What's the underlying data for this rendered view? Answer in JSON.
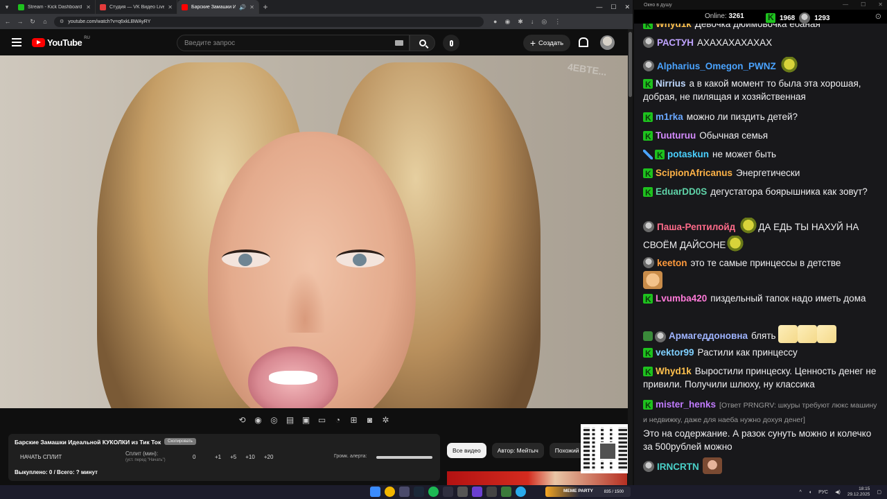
{
  "browser": {
    "tabs": [
      {
        "title": "Stream - Kick Dashboard",
        "color": "#1ec21e"
      },
      {
        "title": "Студия — VK Видео Live",
        "color": "#e33b3b"
      },
      {
        "title": "Барские Замашки Идеальной",
        "color": "#ff0000"
      }
    ],
    "url": "youtube.com/watch?v=q6xkLBWAyRY"
  },
  "youtube": {
    "logo_text": "YouTube",
    "region": "RU",
    "search_placeholder": "Введите запрос",
    "create_label": "Создать",
    "watermark": "4EBTE..."
  },
  "extension": {
    "video_title": "Барские Замашки Идеальной КУКОЛКИ из Тик Ток",
    "copy_pill": "Скопировать",
    "start_split": "НАЧАТЬ СПЛИТ",
    "split_label": "Сплит (мин):",
    "split_hint": "(уст. перед \"Начать\")",
    "split_value": "0",
    "increments": [
      "+1",
      "+5",
      "+10",
      "+20"
    ],
    "volume_label": "Громк. алерта:",
    "bought": "Выкуплено: 0 / Всего: ? минут"
  },
  "chips": [
    "Все видео",
    "Автор: Мейтыч",
    "Похожий к"
  ],
  "chat_window": {
    "title": "Окно в душу",
    "online_label": "Online:",
    "online_count": "3261",
    "kick_count": "1968",
    "twitch_count": "1293"
  },
  "chat": [
    {
      "user": "РАСТУН",
      "color": "#bfa3ff",
      "text": "АХАХАХАХАХАХ",
      "badges": [
        "twitch"
      ]
    },
    {
      "user": "Alpharius_Omegon_PWNZ",
      "color": "#4aa3ff",
      "text": "",
      "badges": [
        "twitch"
      ],
      "emote": "pepe"
    },
    {
      "user": "Nirrius",
      "color": "#bfd9ff",
      "text": "а в какой момент то была эта хорошая, добрая, не пилящая и хозяйственная",
      "badges": [
        "kick"
      ]
    },
    {
      "user": "m1rka",
      "color": "#6aa8ff",
      "text": "можно ли пиздить детей?",
      "badges": [
        "kick"
      ]
    },
    {
      "user": "Tuuturuu",
      "color": "#d58cff",
      "text": "Обычная семья",
      "badges": [
        "kick"
      ]
    },
    {
      "user": "potaskun",
      "color": "#4ad0ff",
      "text": "не может быть",
      "badges": [
        "sword",
        "kick"
      ]
    },
    {
      "user": "ScipionAfricanus",
      "color": "#ffb347",
      "text": "Энергетически",
      "badges": [
        "kick"
      ]
    },
    {
      "user": "EduarDD0S",
      "color": "#5fd3a8",
      "text": "дегустатора боярышника как зовут?",
      "badges": [
        "kick"
      ]
    },
    {
      "user": "Паша-Рептилойд",
      "color": "#ff6b8a",
      "text": "ДА ЕДЬ ТЫ НАХУЙ НА СВОЁМ ДАЙСОНЕ",
      "badges": [
        "twitch"
      ]
    },
    {
      "user": "keeton",
      "color": "#ff9a3c",
      "text": "это те самые принцессы в детстве",
      "badges": [
        "twitch"
      ]
    },
    {
      "user": "Lvumba420",
      "color": "#ff7ad9",
      "text": "пиздельный тапок надо иметь дома",
      "badges": [
        "kick"
      ]
    },
    {
      "user": "Армагеддоновна",
      "color": "#9fb4ff",
      "text": "блять",
      "badges": [
        "shield",
        "twitch"
      ]
    },
    {
      "user": "vektor99",
      "color": "#7fd0ff",
      "text": "Растили как принцессу",
      "badges": [
        "kick"
      ]
    },
    {
      "user": "Whyd1k",
      "color": "#ffc14d",
      "text": "Выростили принцеску. Ценность денег не привили. Получили шлюху, ну классика",
      "badges": [
        "kick"
      ]
    },
    {
      "user": "mister_henks",
      "color": "#c17bff",
      "reply": "[Ответ PRNGRV: шкуры требуют люкс машину и недвижку, даже для наеба нужно дохуя денег]",
      "text": "Это на содержание. А разок сунуть можно и колечко за 500рублей можно",
      "badges": [
        "kick"
      ]
    },
    {
      "user": "IRNCRTN",
      "color": "#4ad0c8",
      "text": "",
      "badges": [
        "twitch"
      ],
      "emote": "face"
    }
  ],
  "taskbar": {
    "meme_label": "MEME PARTY",
    "meme_count": "835 / 1500",
    "lang": "РУС",
    "time": "18:15",
    "date": "29.12.2025"
  }
}
